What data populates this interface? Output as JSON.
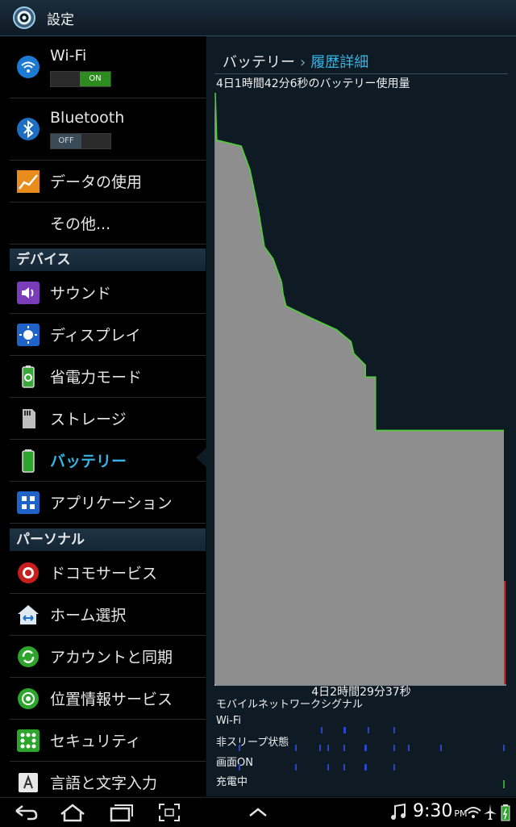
{
  "app": {
    "title": "設定"
  },
  "sidebar": {
    "items": [
      {
        "label": "Wi-Fi",
        "toggle": "ON"
      },
      {
        "label": "Bluetooth",
        "toggle": "OFF"
      },
      {
        "label": "データの使用"
      },
      {
        "label": "その他..."
      }
    ],
    "device_header": "デバイス",
    "device_items": [
      {
        "label": "サウンド"
      },
      {
        "label": "ディスプレイ"
      },
      {
        "label": "省電力モード"
      },
      {
        "label": "ストレージ"
      },
      {
        "label": "バッテリー",
        "selected": true
      },
      {
        "label": "アプリケーション"
      }
    ],
    "personal_header": "パーソナル",
    "personal_items": [
      {
        "label": "ドコモサービス"
      },
      {
        "label": "ホーム選択"
      },
      {
        "label": "アカウントと同期"
      },
      {
        "label": "位置情報サービス"
      },
      {
        "label": "セキュリティ"
      },
      {
        "label": "言語と文字入力"
      }
    ]
  },
  "detail": {
    "breadcrumb": {
      "parent": "バッテリー",
      "separator": "›",
      "current": "履歴詳細"
    },
    "usage_title": "4日1時間42分6秒のバッテリー使用量",
    "time_label": "4日2時間29分37秒",
    "rows": [
      "モバイルネットワークシグナル",
      "Wi-Fi",
      "非スリープ状態",
      "画面ON",
      "充電中"
    ]
  },
  "chart_data": {
    "type": "area",
    "x_unit": "fraction of history",
    "y_unit": "battery %",
    "points": [
      [
        0.0,
        100
      ],
      [
        0.005,
        92
      ],
      [
        0.09,
        91
      ],
      [
        0.12,
        87
      ],
      [
        0.15,
        80
      ],
      [
        0.17,
        74
      ],
      [
        0.2,
        72
      ],
      [
        0.23,
        68
      ],
      [
        0.235,
        66
      ],
      [
        0.245,
        64
      ],
      [
        0.33,
        62
      ],
      [
        0.42,
        60
      ],
      [
        0.47,
        58
      ],
      [
        0.48,
        56
      ],
      [
        0.52,
        54
      ],
      [
        0.52,
        52
      ],
      [
        0.555,
        52
      ],
      [
        0.555,
        43
      ],
      [
        1.0,
        43
      ]
    ],
    "line_color": "#4cd136",
    "fill_color": "#8e8e8e"
  },
  "status_bar": {
    "time": "9:30",
    "ampm": "PM"
  },
  "colors": {
    "accent": "#33b5e5",
    "panel": "#0e1a24"
  }
}
